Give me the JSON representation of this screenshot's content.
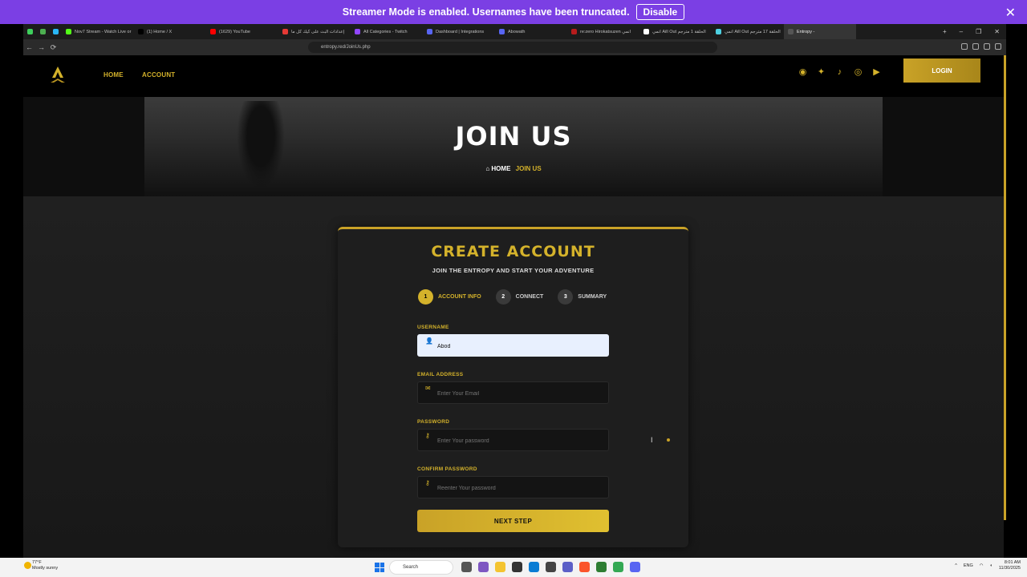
{
  "streamer": {
    "message": "Streamer Mode is enabled. Usernames have been truncated.",
    "disable_label": "Disable",
    "close": "✕"
  },
  "browser": {
    "tabs": [
      {
        "label": "",
        "color": "#3ecf5c"
      },
      {
        "label": "",
        "color": "#4caf50"
      },
      {
        "label": "",
        "color": "#29b6f6"
      },
      {
        "label": "Nov7 Stream - Watch Live or",
        "color": "#53fc18"
      },
      {
        "label": "(1) Home / X",
        "color": "#000000"
      },
      {
        "label": "(1629) YouTube",
        "color": "#ff0000"
      },
      {
        "label": "إعدادات البث على كيك كل ما",
        "color": "#e53935"
      },
      {
        "label": "All Categories - Twitch",
        "color": "#9146ff"
      },
      {
        "label": "Dashboard | Integrations",
        "color": "#5865f2"
      },
      {
        "label": "Abowath",
        "color": "#5865f2"
      },
      {
        "label": "re:zero Hirokatsuzen انمي",
        "color": "#b71c1c"
      },
      {
        "label": "انمي Aill Out الحلقة 1 مترجم",
        "color": "#ffffff"
      },
      {
        "label": "انمي Aill Out الحلقة 17 مترجم",
        "color": "#4dd0e1"
      },
      {
        "label": "Entropy -",
        "color": "#555555",
        "active": true
      }
    ],
    "new_tab": "+",
    "url": "entropy.red/JoinUs.php",
    "back": "←",
    "forward": "→",
    "reload": "⟳"
  },
  "site": {
    "nav": {
      "home": "HOME",
      "account": "ACCOUNT",
      "login": "LOGIN"
    },
    "social_icons": [
      "discord-icon",
      "twitter-icon",
      "tiktok-icon",
      "instagram-icon",
      "youtube-icon"
    ],
    "hero": {
      "title": "JOIN US",
      "crumb_home": "HOME",
      "crumb_current": "JOIN US"
    },
    "form": {
      "title": "CREATE ACCOUNT",
      "subtitle": "JOIN THE ENTROPY AND START YOUR ADVENTURE",
      "steps": [
        {
          "num": "1",
          "label": "ACCOUNT INFO",
          "active": true
        },
        {
          "num": "2",
          "label": "CONNECT"
        },
        {
          "num": "3",
          "label": "SUMMARY"
        }
      ],
      "username": {
        "label": "USERNAME",
        "value": "Abod"
      },
      "email": {
        "label": "EMAIL ADDRESS",
        "placeholder": "Enter Your Email"
      },
      "password": {
        "label": "PASSWORD",
        "placeholder": "Enter Your password"
      },
      "confirm": {
        "label": "CONFIRM PASSWORD",
        "placeholder": "Reenter Your password"
      },
      "next": "NEXT STEP"
    }
  },
  "taskbar": {
    "weather_temp": "77°F",
    "weather_desc": "Mostly sunny",
    "search": "Search",
    "lang": "ENG",
    "time": "8:01 AM",
    "date": "11/30/2025"
  },
  "colors": {
    "accent": "#d4b22b",
    "streamer": "#7b3fe4"
  }
}
